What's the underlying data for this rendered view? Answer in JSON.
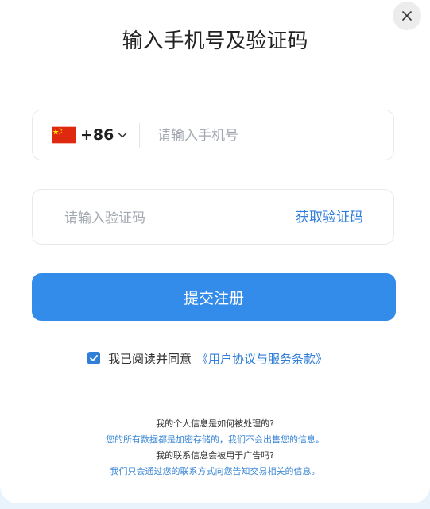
{
  "dialog": {
    "title": "输入手机号及验证码",
    "close_label": "×"
  },
  "phone": {
    "country_code": "+86",
    "flag": "china-flag-icon",
    "placeholder": "请输入手机号",
    "value": ""
  },
  "code": {
    "placeholder": "请输入验证码",
    "value": "",
    "get_code_label": "获取验证码"
  },
  "submit": {
    "label": "提交注册"
  },
  "agreement": {
    "checked": true,
    "text": "我已阅读并同意",
    "link_text": "《用户协议与服务条款》"
  },
  "faq": [
    {
      "question": "我的个人信息是如何被处理的?",
      "answer": "您的所有数据都是加密存储的，我们不会出售您的信息。"
    },
    {
      "question": "我的联系信息会被用于广告吗?",
      "answer": "我们只会通过您的联系方式向您告知交易相关的信息。"
    }
  ],
  "colors": {
    "accent": "#338bea",
    "link": "#2f7ed8",
    "background": "#e8f3fb"
  }
}
